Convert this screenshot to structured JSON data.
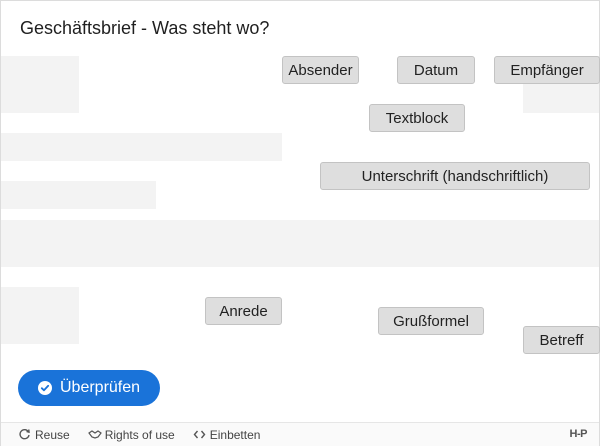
{
  "title": "Geschäftsbrief - Was steht wo?",
  "draggables": {
    "absender": "Absender",
    "datum": "Datum",
    "empfaenger": "Empfänger",
    "textblock": "Textblock",
    "unterschrift": "Unterschrift (handschriftlich)",
    "anrede": "Anrede",
    "grussformel": "Grußformel",
    "betreff": "Betreff"
  },
  "check_button": {
    "label": "Überprüfen",
    "icon": "check-circle-icon"
  },
  "footer": {
    "reuse": "Reuse",
    "rights": "Rights of use",
    "embed": "Einbetten",
    "logo": "H-P"
  },
  "colors": {
    "primary": "#1a73d9",
    "drop_zone": "#f3f3f3",
    "draggable": "#dedede"
  }
}
